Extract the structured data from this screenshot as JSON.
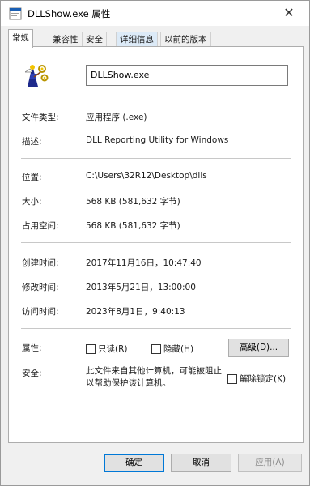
{
  "window": {
    "title": "DLLShow.exe 属性",
    "close_glyph": "✕"
  },
  "tabs": [
    {
      "label": "常规",
      "active": true
    },
    {
      "label": "兼容性"
    },
    {
      "label": "安全"
    },
    {
      "label": "详细信息"
    },
    {
      "label": "以前的版本"
    }
  ],
  "general": {
    "filename": "DLLShow.exe",
    "file_type_label": "文件类型:",
    "file_type_value": "应用程序 (.exe)",
    "description_label": "描述:",
    "description_value": "DLL Reporting Utility for Windows",
    "location_label": "位置:",
    "location_value": "C:\\Users\\32R12\\Desktop\\dlls",
    "size_label": "大小:",
    "size_value": "568 KB (581,632 字节)",
    "size_on_disk_label": "占用空间:",
    "size_on_disk_value": "568 KB (581,632 字节)",
    "created_label": "创建时间:",
    "created_value": "2017年11月16日，10:47:40",
    "modified_label": "修改时间:",
    "modified_value": "2013年5月21日，13:00:00",
    "accessed_label": "访问时间:",
    "accessed_value": "2023年8月1日，9:40:13",
    "attributes_label": "属性:",
    "readonly_label": "只读(R)",
    "hidden_label": "隐藏(H)",
    "advanced_button": "高级(D)...",
    "security_label": "安全:",
    "security_text": "此文件来自其他计算机，可能被阻止以帮助保护该计算机。",
    "unblock_label": "解除锁定(K)"
  },
  "footer": {
    "ok_label": "确定",
    "cancel_label": "取消",
    "apply_label": "应用(A)"
  },
  "colors": {
    "accent": "#0078d7",
    "window_bg": "#f0f0f0",
    "panel_bg": "#ffffff"
  }
}
